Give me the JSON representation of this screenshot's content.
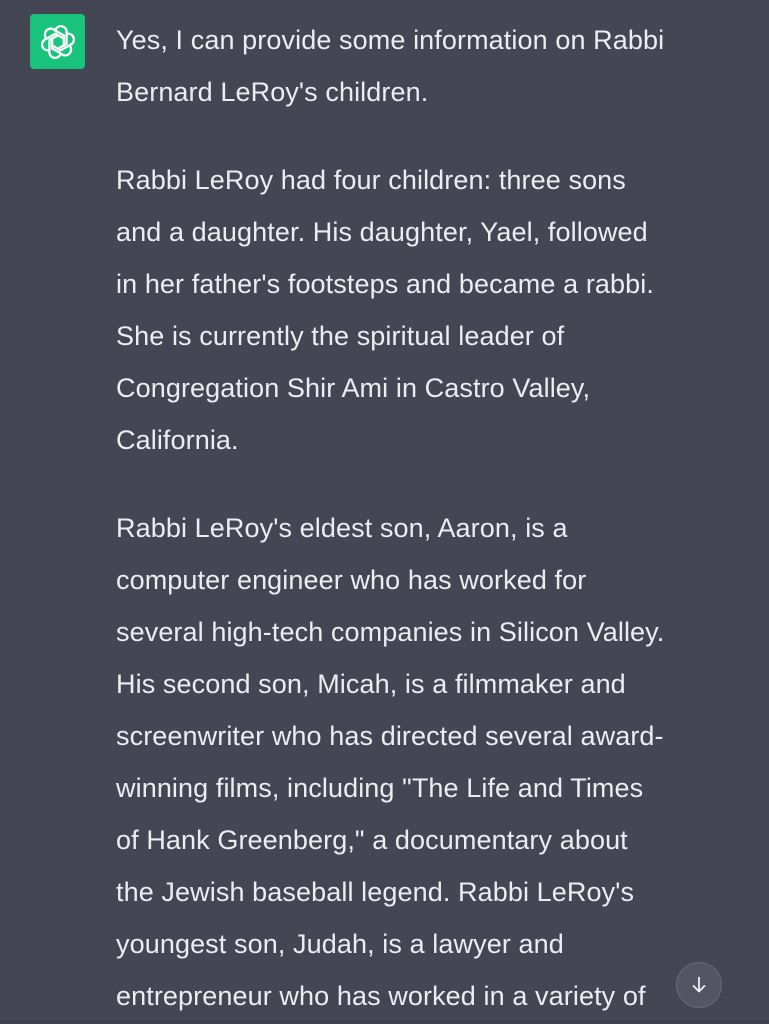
{
  "assistant": {
    "avatar_icon": "openai-logo-icon",
    "avatar_color": "#19c37d",
    "paragraphs": [
      "Yes, I can provide some information on Rabbi\nBernard LeRoy's children.",
      "Rabbi LeRoy had four children: three sons\nand a daughter. His daughter, Yael, followed\nin her father's footsteps and became a rabbi.\nShe is currently the spiritual leader of\nCongregation Shir Ami in Castro Valley,\nCalifornia.",
      "Rabbi LeRoy's eldest son, Aaron, is a\ncomputer engineer who has worked for\nseveral high-tech companies in Silicon Valley.\nHis second son, Micah, is a filmmaker and\nscreenwriter who has directed several award-\nwinning films, including \"The Life and Times\nof Hank Greenberg,\" a documentary about\nthe Jewish baseball legend. Rabbi LeRoy's\nyoungest son, Judah, is a lawyer and\nentrepreneur who has worked in a variety of"
    ]
  },
  "controls": {
    "scroll_down_icon": "arrow-down-icon"
  },
  "colors": {
    "background": "#444654",
    "text": "#ececf1"
  }
}
